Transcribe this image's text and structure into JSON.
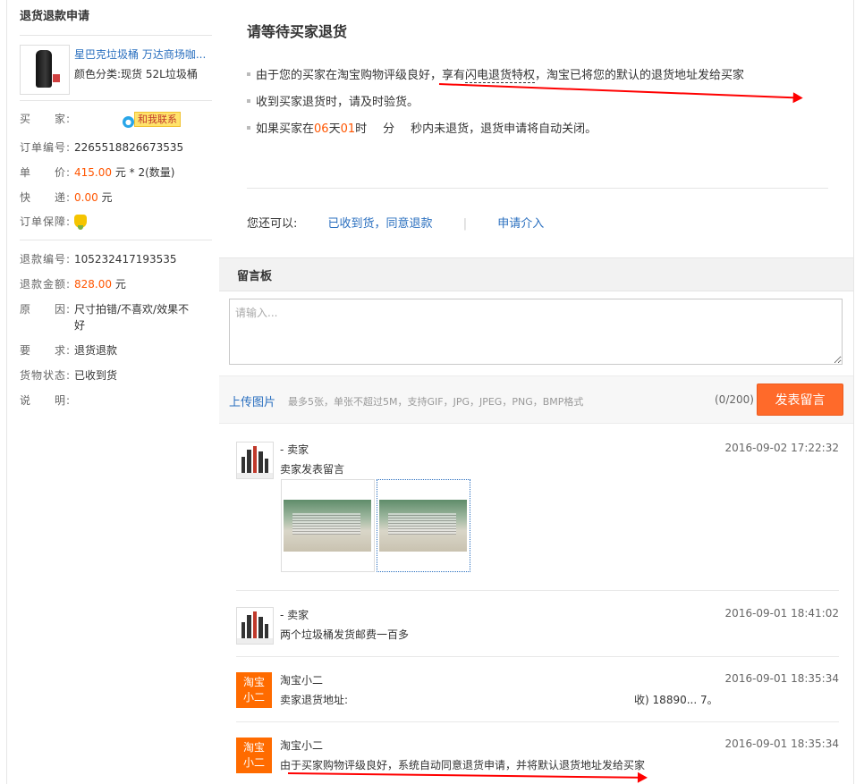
{
  "sidebar": {
    "title": "退货退款申请",
    "product": {
      "name": "星巴克垃圾桶 万达商场咖...",
      "spec": "颜色分类:现货 52L垃圾桶"
    },
    "order_info": {
      "buyer_label": "买　　家:",
      "buyer_name": "",
      "contact_label": "和我联系",
      "order_no_label": "订单编号:",
      "order_no": "2265518826673535",
      "price_label": "单　　价:",
      "price": "415.00",
      "price_suffix": " 元 * 2(数量)",
      "shipping_label": "快　　递:",
      "shipping": "0.00",
      "shipping_suffix": " 元",
      "guarantee_label": "订单保障:"
    },
    "refund_info": {
      "refund_no_label": "退款编号:",
      "refund_no": "105232417193535",
      "amount_label": "退款金额:",
      "amount": "828.00",
      "amount_suffix": " 元",
      "reason_label": "原　　因:",
      "reason": "尺寸拍错/不喜欢/效果不好",
      "request_label": "要　　求:",
      "request": "退货退款",
      "goods_status_label": "货物状态:",
      "goods_status": "已收到货",
      "note_label": "说　　明:",
      "note": ""
    }
  },
  "status": {
    "title": "请等待买家退货",
    "line1_a": "由于您的买家在淘宝购物评级良好，享有",
    "line1_link": "闪电退货特权",
    "line1_b": "，淘宝已将您的默认的退货地址发给买家",
    "line2": "收到买家退货时，请及时验货。",
    "line3_prefix": "如果买家在",
    "days": "06",
    "days_unit": "天",
    "hours": "01",
    "hours_unit": "时",
    "minutes_unit": "分",
    "seconds_unit": "秒",
    "line3_suffix": "内未退货，退货申请将自动关闭。",
    "actions_label": "您还可以:",
    "action_confirm": "已收到货，同意退款",
    "action_intervene": "申请介入"
  },
  "message_board": {
    "title": "留言板",
    "input_placeholder": "请输入...",
    "upload_label": "上传图片",
    "upload_hint": "最多5张，单张不超过5M，支持GIF，JPG，JPEG，PNG，BMP格式",
    "counter": "(0/200)",
    "submit_label": "发表留言",
    "messages": [
      {
        "name": "- 卖家",
        "time": "2016-09-02 17:22:32",
        "text": "卖家发表留言",
        "avatar": "store-logo"
      },
      {
        "name": "- 卖家",
        "time": "2016-09-01 18:41:02",
        "text": "两个垃圾桶发货邮费一百多",
        "avatar": "store-logo"
      },
      {
        "name": "淘宝小二",
        "time": "2016-09-01 18:35:34",
        "text": "卖家退货地址:",
        "text_tail": "收) 18890... 7。",
        "avatar": "淘宝小二"
      },
      {
        "name": "淘宝小二",
        "time": "2016-09-01 18:35:34",
        "text": "由于买家购物评级良好，系统自动同意退货申请，并将默认退货地址发给买家",
        "avatar": "淘宝小二"
      }
    ],
    "xiaoer_avatar_line1": "淘宝",
    "xiaoer_avatar_line2": "小二"
  },
  "colors": {
    "link": "#2a6fbf",
    "accent": "#ff5500",
    "button": "#ff6a2a",
    "annotation_arrow": "#ff0000"
  }
}
